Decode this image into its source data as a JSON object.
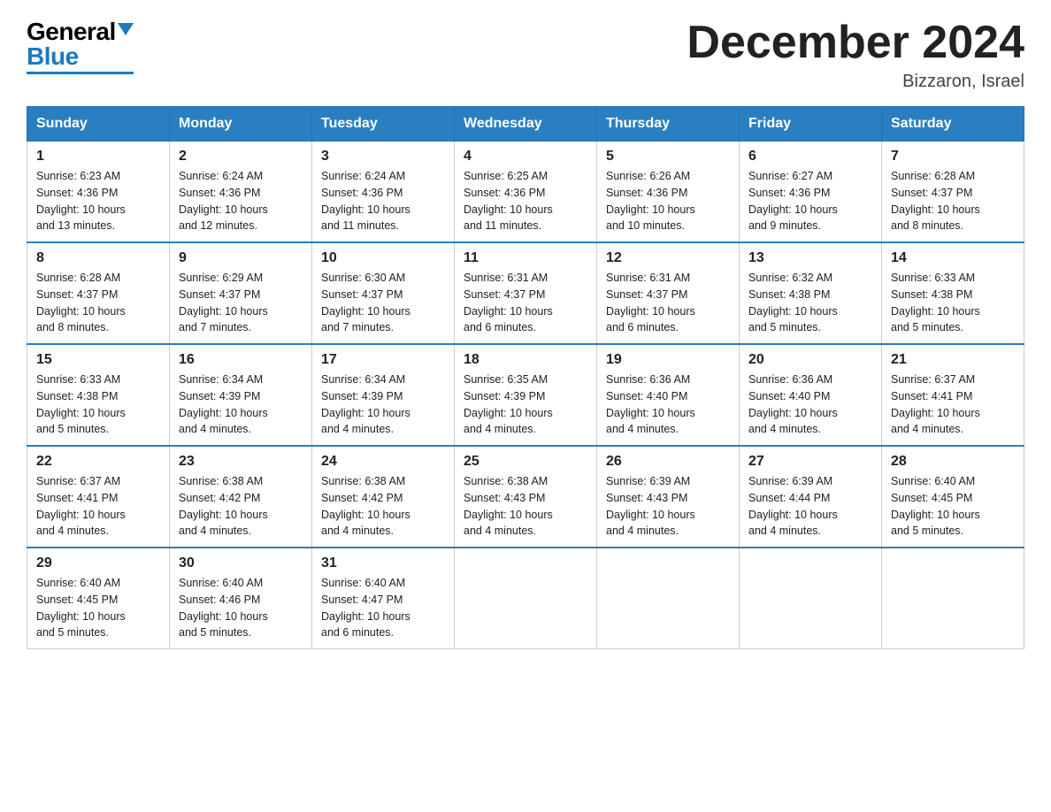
{
  "header": {
    "logo_general": "General",
    "logo_blue": "Blue",
    "title": "December 2024",
    "location": "Bizzaron, Israel"
  },
  "days_of_week": [
    "Sunday",
    "Monday",
    "Tuesday",
    "Wednesday",
    "Thursday",
    "Friday",
    "Saturday"
  ],
  "weeks": [
    [
      {
        "day": "1",
        "sunrise": "6:23 AM",
        "sunset": "4:36 PM",
        "daylight": "10 hours and 13 minutes."
      },
      {
        "day": "2",
        "sunrise": "6:24 AM",
        "sunset": "4:36 PM",
        "daylight": "10 hours and 12 minutes."
      },
      {
        "day": "3",
        "sunrise": "6:24 AM",
        "sunset": "4:36 PM",
        "daylight": "10 hours and 11 minutes."
      },
      {
        "day": "4",
        "sunrise": "6:25 AM",
        "sunset": "4:36 PM",
        "daylight": "10 hours and 11 minutes."
      },
      {
        "day": "5",
        "sunrise": "6:26 AM",
        "sunset": "4:36 PM",
        "daylight": "10 hours and 10 minutes."
      },
      {
        "day": "6",
        "sunrise": "6:27 AM",
        "sunset": "4:36 PM",
        "daylight": "10 hours and 9 minutes."
      },
      {
        "day": "7",
        "sunrise": "6:28 AM",
        "sunset": "4:37 PM",
        "daylight": "10 hours and 8 minutes."
      }
    ],
    [
      {
        "day": "8",
        "sunrise": "6:28 AM",
        "sunset": "4:37 PM",
        "daylight": "10 hours and 8 minutes."
      },
      {
        "day": "9",
        "sunrise": "6:29 AM",
        "sunset": "4:37 PM",
        "daylight": "10 hours and 7 minutes."
      },
      {
        "day": "10",
        "sunrise": "6:30 AM",
        "sunset": "4:37 PM",
        "daylight": "10 hours and 7 minutes."
      },
      {
        "day": "11",
        "sunrise": "6:31 AM",
        "sunset": "4:37 PM",
        "daylight": "10 hours and 6 minutes."
      },
      {
        "day": "12",
        "sunrise": "6:31 AM",
        "sunset": "4:37 PM",
        "daylight": "10 hours and 6 minutes."
      },
      {
        "day": "13",
        "sunrise": "6:32 AM",
        "sunset": "4:38 PM",
        "daylight": "10 hours and 5 minutes."
      },
      {
        "day": "14",
        "sunrise": "6:33 AM",
        "sunset": "4:38 PM",
        "daylight": "10 hours and 5 minutes."
      }
    ],
    [
      {
        "day": "15",
        "sunrise": "6:33 AM",
        "sunset": "4:38 PM",
        "daylight": "10 hours and 5 minutes."
      },
      {
        "day": "16",
        "sunrise": "6:34 AM",
        "sunset": "4:39 PM",
        "daylight": "10 hours and 4 minutes."
      },
      {
        "day": "17",
        "sunrise": "6:34 AM",
        "sunset": "4:39 PM",
        "daylight": "10 hours and 4 minutes."
      },
      {
        "day": "18",
        "sunrise": "6:35 AM",
        "sunset": "4:39 PM",
        "daylight": "10 hours and 4 minutes."
      },
      {
        "day": "19",
        "sunrise": "6:36 AM",
        "sunset": "4:40 PM",
        "daylight": "10 hours and 4 minutes."
      },
      {
        "day": "20",
        "sunrise": "6:36 AM",
        "sunset": "4:40 PM",
        "daylight": "10 hours and 4 minutes."
      },
      {
        "day": "21",
        "sunrise": "6:37 AM",
        "sunset": "4:41 PM",
        "daylight": "10 hours and 4 minutes."
      }
    ],
    [
      {
        "day": "22",
        "sunrise": "6:37 AM",
        "sunset": "4:41 PM",
        "daylight": "10 hours and 4 minutes."
      },
      {
        "day": "23",
        "sunrise": "6:38 AM",
        "sunset": "4:42 PM",
        "daylight": "10 hours and 4 minutes."
      },
      {
        "day": "24",
        "sunrise": "6:38 AM",
        "sunset": "4:42 PM",
        "daylight": "10 hours and 4 minutes."
      },
      {
        "day": "25",
        "sunrise": "6:38 AM",
        "sunset": "4:43 PM",
        "daylight": "10 hours and 4 minutes."
      },
      {
        "day": "26",
        "sunrise": "6:39 AM",
        "sunset": "4:43 PM",
        "daylight": "10 hours and 4 minutes."
      },
      {
        "day": "27",
        "sunrise": "6:39 AM",
        "sunset": "4:44 PM",
        "daylight": "10 hours and 4 minutes."
      },
      {
        "day": "28",
        "sunrise": "6:40 AM",
        "sunset": "4:45 PM",
        "daylight": "10 hours and 5 minutes."
      }
    ],
    [
      {
        "day": "29",
        "sunrise": "6:40 AM",
        "sunset": "4:45 PM",
        "daylight": "10 hours and 5 minutes."
      },
      {
        "day": "30",
        "sunrise": "6:40 AM",
        "sunset": "4:46 PM",
        "daylight": "10 hours and 5 minutes."
      },
      {
        "day": "31",
        "sunrise": "6:40 AM",
        "sunset": "4:47 PM",
        "daylight": "10 hours and 6 minutes."
      },
      null,
      null,
      null,
      null
    ]
  ]
}
